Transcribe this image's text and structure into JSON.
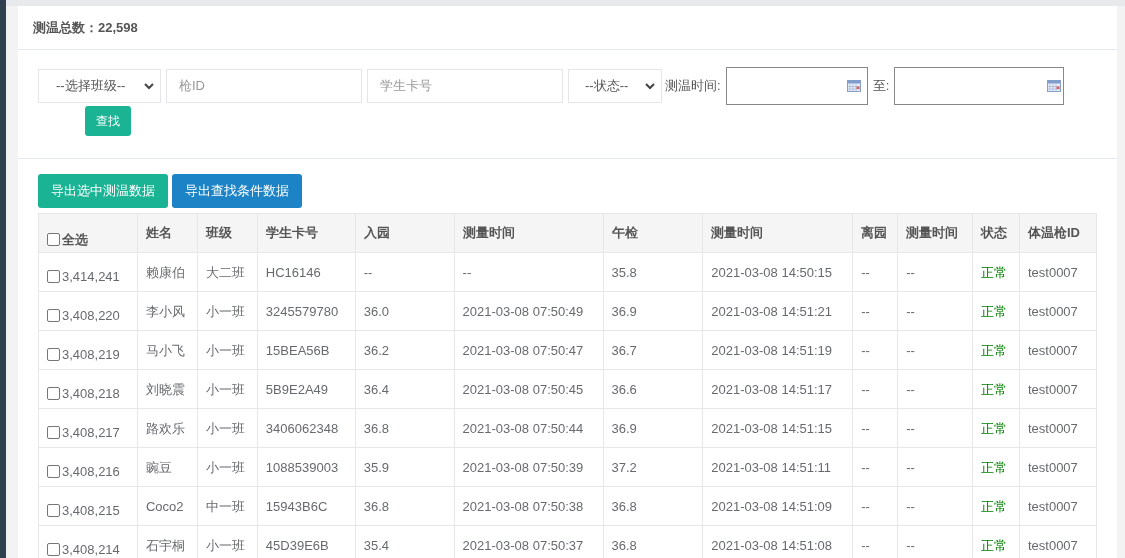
{
  "summary": {
    "label": "测温总数：22,598"
  },
  "filters": {
    "class_select": "--选择班级--",
    "gun_id": {
      "placeholder": "枪ID"
    },
    "card_no": {
      "placeholder": "学生卡号"
    },
    "status_select": "--状态--",
    "time_label": "测温时间:",
    "to_label": "至:",
    "search_button": "查找"
  },
  "export_buttons": [
    "导出选中测温数据",
    "导出查找条件数据"
  ],
  "table": {
    "select_all": {
      "checked": false
    },
    "columns": [
      "全选",
      "姓名",
      "班级",
      "学生卡号",
      "入园",
      "测量时间",
      "午检",
      "测量时间",
      "离园",
      "测量时间",
      "状态",
      "体温枪ID"
    ],
    "rows": [
      {
        "checked": false,
        "cells": [
          "3,414,241",
          "赖康伯",
          "大二班",
          "HC16146",
          "--",
          "--",
          "35.8",
          "2021-03-08 14:50:15",
          "--",
          "--",
          "正常",
          "test0007"
        ]
      },
      {
        "checked": false,
        "cells": [
          "3,408,220",
          "李小风",
          "小一班",
          "3245579780",
          "36.0",
          "2021-03-08 07:50:49",
          "36.9",
          "2021-03-08 14:51:21",
          "--",
          "--",
          "正常",
          "test0007"
        ]
      },
      {
        "checked": false,
        "cells": [
          "3,408,219",
          "马小飞",
          "小一班",
          "15BEA56B",
          "36.2",
          "2021-03-08 07:50:47",
          "36.7",
          "2021-03-08 14:51:19",
          "--",
          "--",
          "正常",
          "test0007"
        ]
      },
      {
        "checked": false,
        "cells": [
          "3,408,218",
          "刘晓震",
          "小一班",
          "5B9E2A49",
          "36.4",
          "2021-03-08 07:50:45",
          "36.6",
          "2021-03-08 14:51:17",
          "--",
          "--",
          "正常",
          "test0007"
        ]
      },
      {
        "checked": false,
        "cells": [
          "3,408,217",
          "路欢乐",
          "小一班",
          "3406062348",
          "36.8",
          "2021-03-08 07:50:44",
          "36.9",
          "2021-03-08 14:51:15",
          "--",
          "--",
          "正常",
          "test0007"
        ]
      },
      {
        "checked": false,
        "cells": [
          "3,408,216",
          "豌豆",
          "小一班",
          "1088539003",
          "35.9",
          "2021-03-08 07:50:39",
          "37.2",
          "2021-03-08 14:51:11",
          "--",
          "--",
          "正常",
          "test0007"
        ]
      },
      {
        "checked": false,
        "cells": [
          "3,408,215",
          "Coco2",
          "中一班",
          "15943B6C",
          "36.8",
          "2021-03-08 07:50:38",
          "36.8",
          "2021-03-08 14:51:09",
          "--",
          "--",
          "正常",
          "test0007"
        ]
      },
      {
        "checked": false,
        "cells": [
          "3,408,214",
          "石宇桐",
          "小一班",
          "45D39E6B",
          "35.4",
          "2021-03-08 07:50:37",
          "36.8",
          "2021-03-08 14:51:08",
          "--",
          "--",
          "正常",
          "test0007"
        ]
      }
    ]
  }
}
